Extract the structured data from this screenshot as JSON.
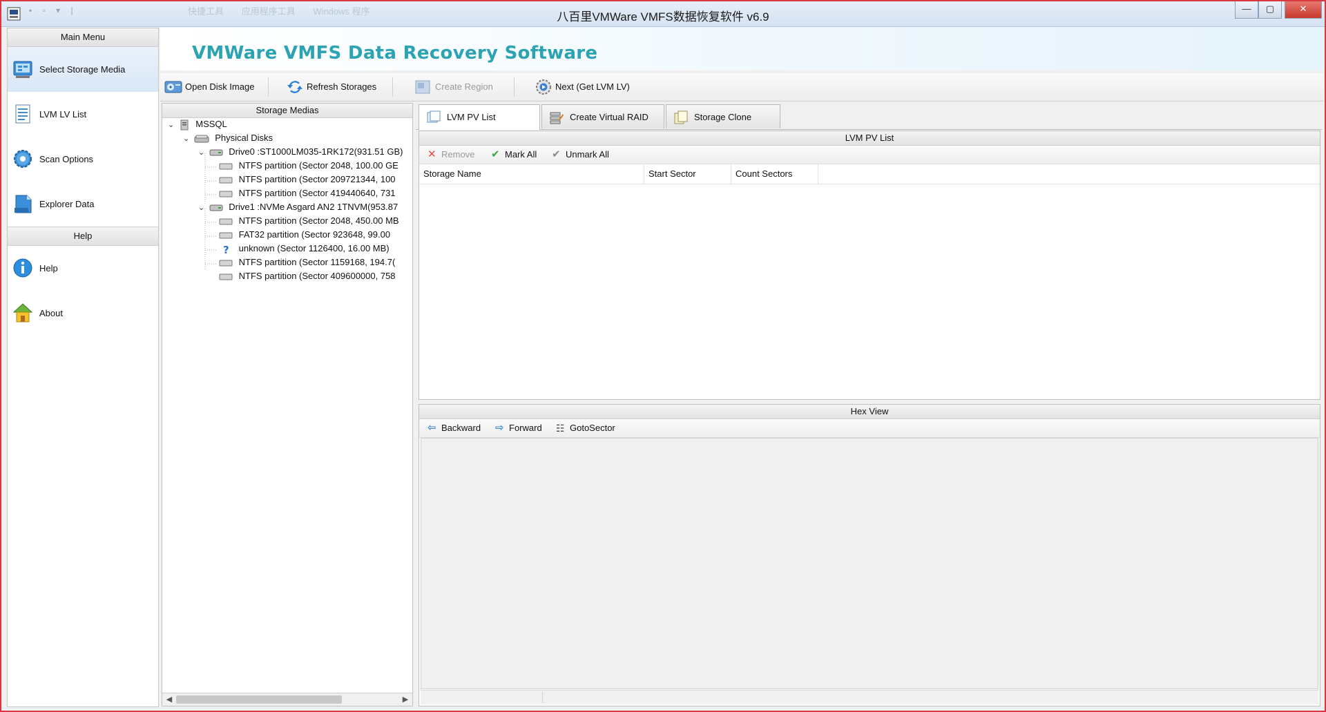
{
  "window": {
    "title": "八百里VMWare VMFS数据恢复软件 v6.9",
    "quick_access": "▪ ▫ ▾ |",
    "ribbon_tabs": [
      "快捷工具",
      "应用程序工具",
      "Windows 程序"
    ],
    "minimize": "—",
    "maximize": "▢",
    "close": "✕"
  },
  "sidebar": {
    "main_menu_header": "Main Menu",
    "items": [
      {
        "label": "Select Storage Media",
        "icon": "storage-media-icon",
        "selected": true
      },
      {
        "label": "LVM LV List",
        "icon": "list-icon"
      },
      {
        "label": "Scan Options",
        "icon": "gear-icon"
      },
      {
        "label": "Explorer Data",
        "icon": "explorer-icon"
      }
    ],
    "help_header": "Help",
    "help_items": [
      {
        "label": "Help",
        "icon": "info-icon"
      },
      {
        "label": "About",
        "icon": "home-icon"
      }
    ]
  },
  "banner": {
    "title": "VMWare VMFS Data Recovery Software"
  },
  "toolbar": {
    "open_disk_image": "Open Disk Image",
    "refresh_storages": "Refresh Storages",
    "create_region": "Create Region",
    "next_get_lvm": "Next (Get LVM LV)"
  },
  "storage_tree": {
    "header": "Storage Medias",
    "root": "MSSQL",
    "physical_disks": "Physical Disks",
    "drive0": "Drive0 :ST1000LM035-1RK172(931.51 GB)",
    "drive0_parts": [
      "NTFS partition (Sector 2048, 100.00 GE",
      "NTFS partition (Sector 209721344, 100",
      "NTFS partition (Sector 419440640, 731"
    ],
    "drive1": "Drive1 :NVMe    Asgard AN2 1TNVM(953.87",
    "drive1_parts": [
      "NTFS partition (Sector 2048, 450.00 MB",
      "FAT32 partition (Sector 923648, 99.00",
      "unknown (Sector 1126400, 16.00 MB)",
      "NTFS partition (Sector 1159168, 194.7(",
      "NTFS partition (Sector 409600000, 758"
    ]
  },
  "tabs": [
    {
      "label": "LVM PV List",
      "active": true
    },
    {
      "label": "Create Virtual RAID"
    },
    {
      "label": "Storage Clone"
    }
  ],
  "pv_list": {
    "header": "LVM PV List",
    "remove": "Remove",
    "mark_all": "Mark All",
    "unmark_all": "Unmark All",
    "columns": [
      "Storage Name",
      "Start Sector",
      "Count Sectors"
    ]
  },
  "hex_view": {
    "header": "Hex View",
    "backward": "Backward",
    "forward": "Forward",
    "goto_sector": "GotoSector"
  }
}
